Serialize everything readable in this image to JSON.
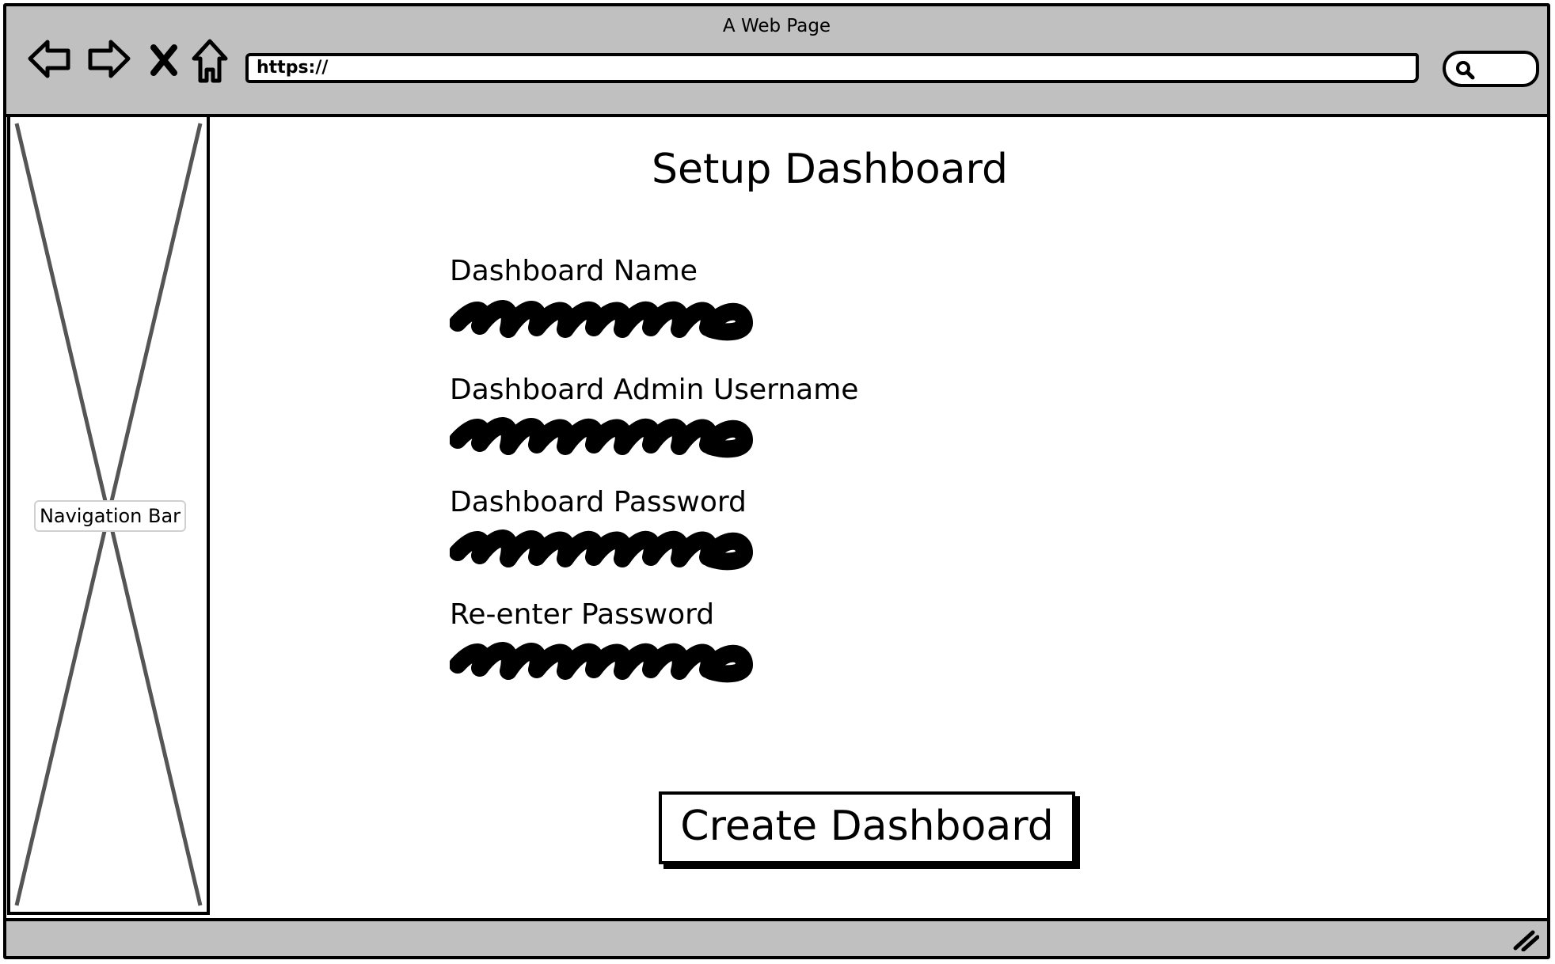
{
  "window": {
    "title": "A Web Page"
  },
  "browser": {
    "url_value": "https://",
    "icons": [
      "back-arrow-icon",
      "forward-arrow-icon",
      "stop-x-icon",
      "home-icon",
      "search-icon",
      "resize-handle-icon"
    ]
  },
  "sidebar": {
    "label": "Navigation Bar"
  },
  "main": {
    "title": "Setup Dashboard",
    "fields": [
      {
        "label": "Dashboard Name"
      },
      {
        "label": "Dashboard Admin Username"
      },
      {
        "label": "Dashboard Password"
      },
      {
        "label": "Re-enter Password"
      }
    ],
    "submit_label": "Create Dashboard"
  }
}
